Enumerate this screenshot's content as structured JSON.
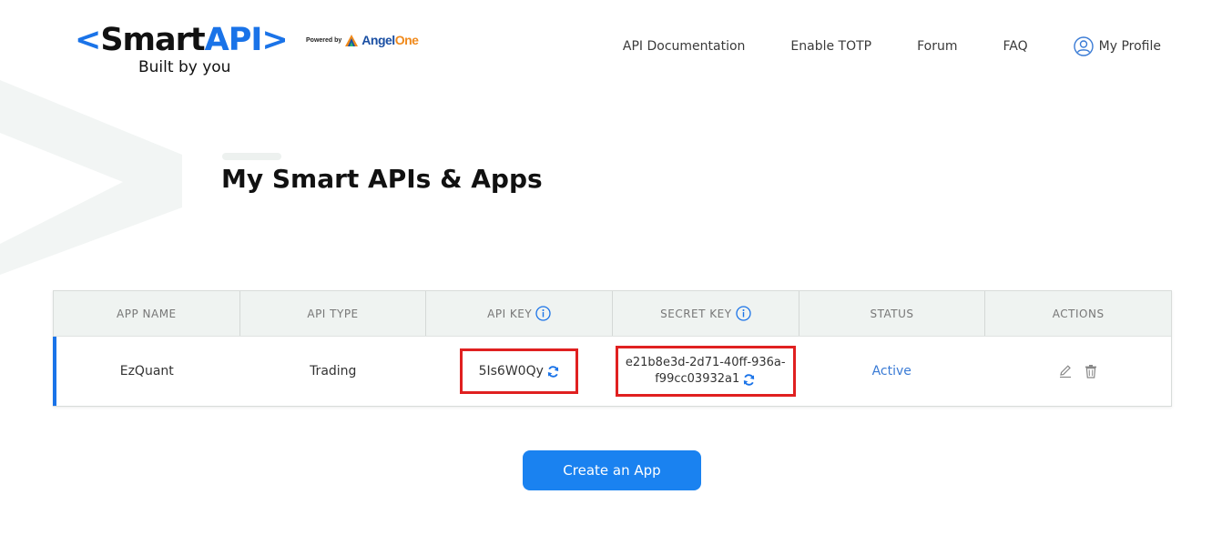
{
  "logo": {
    "bracket_open": "<",
    "smart": "Smart",
    "api": "API",
    "bracket_close": ">",
    "tagline": "Built by you",
    "powered_by": "Powered by",
    "partner_first": "Angel",
    "partner_second": "One"
  },
  "nav": {
    "items": [
      {
        "label": "API Documentation"
      },
      {
        "label": "Enable TOTP"
      },
      {
        "label": "Forum"
      },
      {
        "label": "FAQ"
      }
    ],
    "profile_label": "My Profile"
  },
  "page": {
    "title": "My Smart APIs & Apps"
  },
  "table": {
    "columns": [
      "APP NAME",
      "API TYPE",
      "API KEY",
      "SECRET KEY",
      "STATUS",
      "ACTIONS"
    ],
    "rows": [
      {
        "app_name": "EzQuant",
        "api_type": "Trading",
        "api_key": "5Is6W0Qy",
        "secret_key_line1": "e21b8e3d-2d71-40ff-936a-",
        "secret_key_line2": "f99cc03932a1",
        "status": "Active"
      }
    ]
  },
  "actions": {
    "create_label": "Create an App"
  },
  "colors": {
    "brand_blue": "#1a73e8",
    "button_blue": "#1a82f0",
    "highlight_red": "#e02020",
    "angel_orange": "#f08a1c"
  },
  "icons": [
    "user-circle-icon",
    "info-icon",
    "refresh-icon",
    "edit-icon",
    "trash-icon",
    "angel-one-logo-icon"
  ]
}
